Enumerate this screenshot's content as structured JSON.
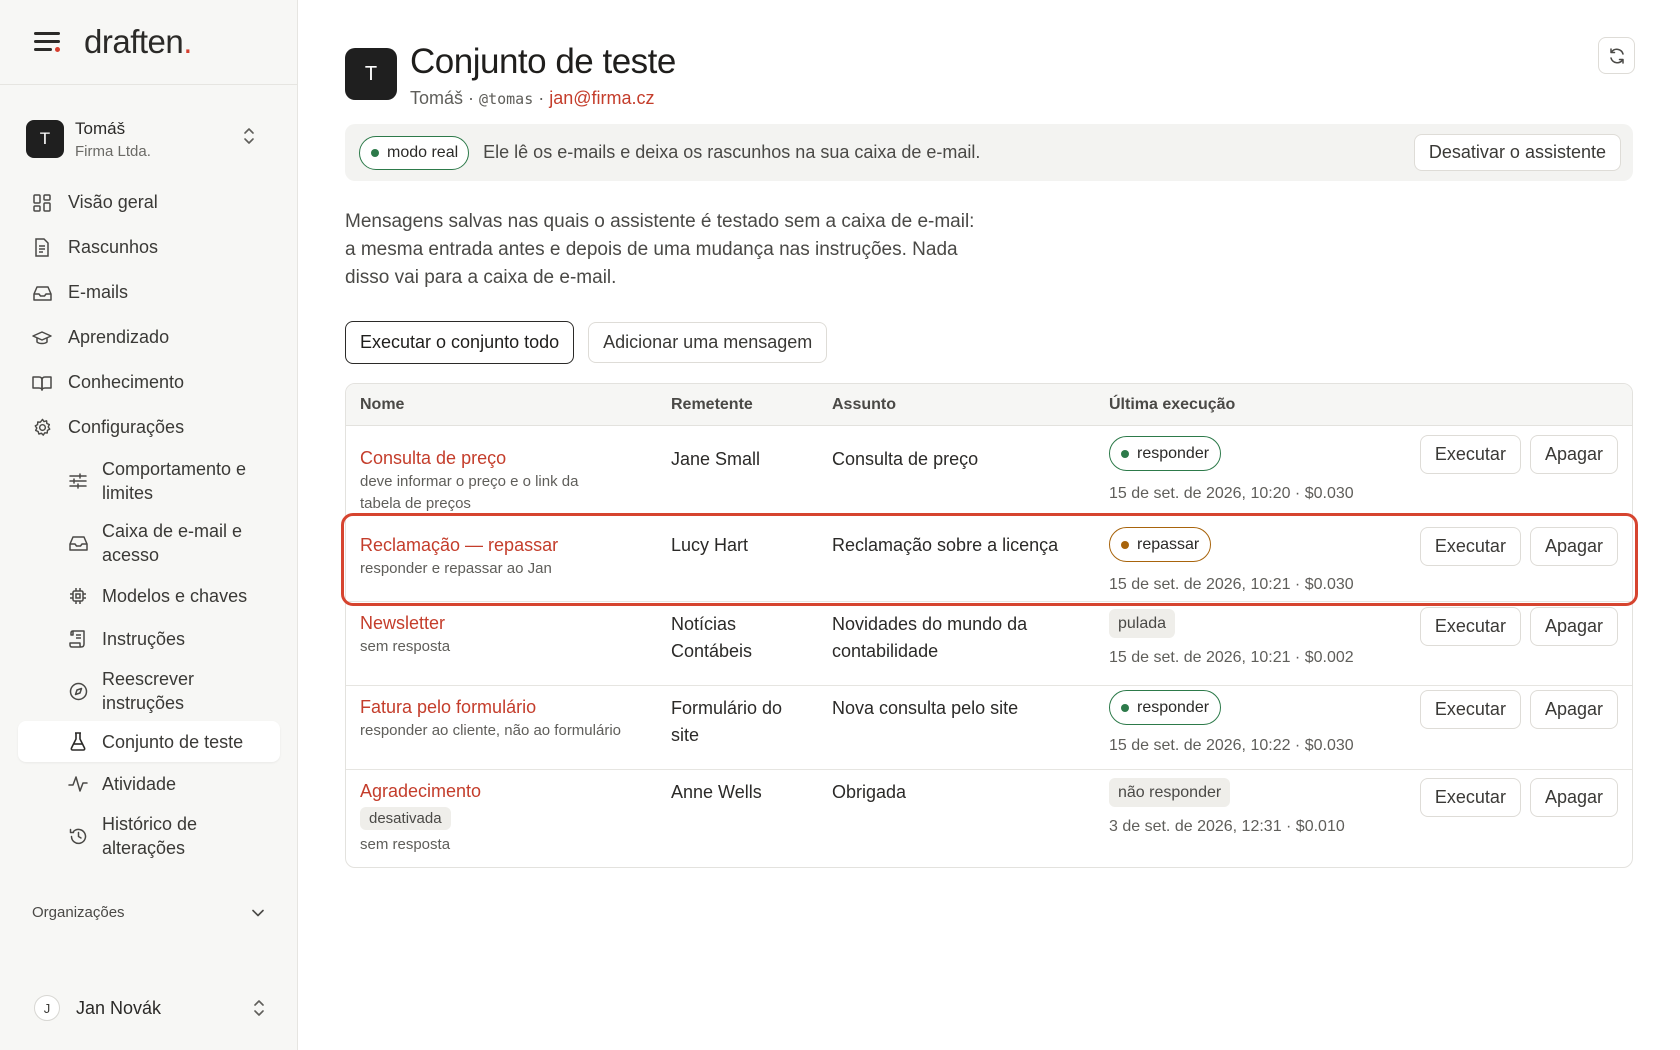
{
  "app": {
    "logo": "draften",
    "logo_dot": "."
  },
  "account": {
    "initial": "T",
    "name": "Tomáš",
    "company": "Firma Ltda."
  },
  "nav": {
    "items": [
      {
        "label": "Visão geral",
        "icon": "grid-icon"
      },
      {
        "label": "Rascunhos",
        "icon": "document-icon"
      },
      {
        "label": "E-mails",
        "icon": "inbox-icon"
      },
      {
        "label": "Aprendizado",
        "icon": "graduation-cap-icon"
      },
      {
        "label": "Conhecimento",
        "icon": "book-icon"
      },
      {
        "label": "Configurações",
        "icon": "gear-icon"
      }
    ],
    "sub_items": [
      {
        "label": "Comportamento e limites",
        "icon": "sliders-icon"
      },
      {
        "label": "Caixa de e-mail e acesso",
        "icon": "inbox-icon"
      },
      {
        "label": "Modelos e chaves",
        "icon": "chip-icon"
      },
      {
        "label": "Instruções",
        "icon": "scroll-icon"
      },
      {
        "label": "Reescrever instruções",
        "icon": "compass-icon"
      },
      {
        "label": "Conjunto de teste",
        "icon": "flask-icon",
        "active": true
      },
      {
        "label": "Atividade",
        "icon": "activity-icon"
      },
      {
        "label": "Histórico de alterações",
        "icon": "history-icon"
      }
    ],
    "orgs_label": "Organizações"
  },
  "user": {
    "initial": "J",
    "name": "Jan Novák"
  },
  "header": {
    "initial": "T",
    "title": "Conjunto de teste",
    "owner": "Tomáš",
    "separator": "·",
    "handle": "@tomas",
    "email": "jan@firma.cz"
  },
  "banner": {
    "mode": "modo real",
    "text": "Ele lê os e-mails e deixa os rascunhos na sua caixa de e-mail.",
    "button": "Desativar o assistente"
  },
  "description": "Mensagens salvas nas quais o assistente é testado sem a caixa de e-mail: a mesma entrada antes e depois de uma mudança nas instruções. Nada disso vai para a caixa de e-mail.",
  "actions": {
    "run_all": "Executar o conjunto todo",
    "add": "Adicionar uma mensagem"
  },
  "table": {
    "columns": {
      "name": "Nome",
      "sender": "Remetente",
      "subject": "Assunto",
      "last_run": "Última execução"
    },
    "run_label": "Executar",
    "delete_label": "Apagar",
    "rows": [
      {
        "name": "Consulta de preço",
        "tag": "",
        "note": "deve informar o preço e o link da tabela de preços",
        "sender": "Jane Small",
        "subject": "Consulta de preço",
        "status": "responder",
        "status_style": "green",
        "meta": "15 de set. de 2026, 10:20 · $0.030"
      },
      {
        "name": "Reclamação — repassar",
        "tag": "",
        "note": "responder e repassar ao Jan",
        "sender": "Lucy Hart",
        "subject": "Reclamação sobre a licença",
        "status": "repassar",
        "status_style": "amber",
        "meta": "15 de set. de 2026, 10:21 · $0.030"
      },
      {
        "name": "Newsletter",
        "tag": "",
        "note": "sem resposta",
        "sender": "Notícias Contábeis",
        "subject": "Novidades do mundo da contabilidade",
        "status": "pulada",
        "status_style": "plain",
        "meta": "15 de set. de 2026, 10:21 · $0.002"
      },
      {
        "name": "Fatura pelo formulário",
        "tag": "",
        "note": "responder ao cliente, não ao formulário",
        "sender": "Formulário do site",
        "subject": "Nova consulta pelo site",
        "status": "responder",
        "status_style": "green",
        "meta": "15 de set. de 2026, 10:22 · $0.030"
      },
      {
        "name": "Agradecimento",
        "tag": "desativada",
        "note": "sem resposta",
        "sender": "Anne Wells",
        "subject": "Obrigada",
        "status": "não responder",
        "status_style": "plain",
        "meta": "3 de set. de 2026, 12:31 · $0.010"
      }
    ]
  },
  "colors": {
    "accent": "#c43d2b",
    "green": "#2d7a4a",
    "amber": "#a8640c",
    "highlight": "#d6442f"
  }
}
